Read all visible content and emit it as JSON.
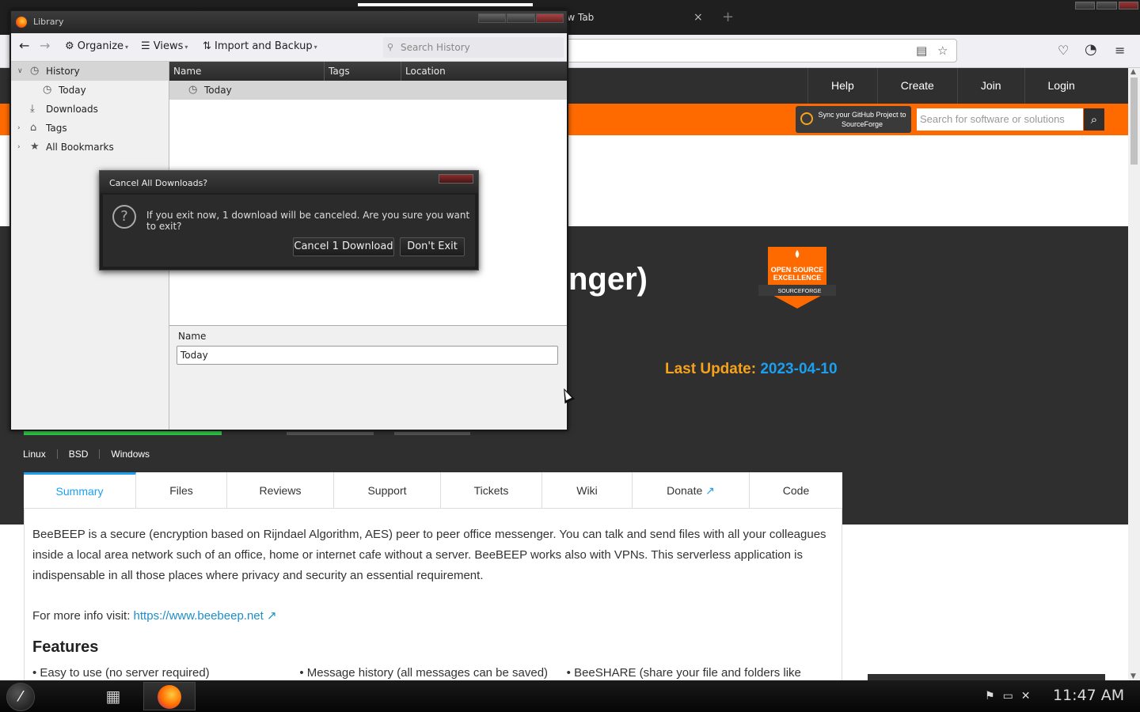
{
  "browser": {
    "tab_title": "New Tab",
    "tab_close": "×",
    "new_tab": "+",
    "reader_icon": "reader-view-icon",
    "bookmark_icon": "star-icon",
    "pocket_icon": "pocket-icon",
    "account_icon": "account-icon",
    "menu_icon": "hamburger-menu-icon"
  },
  "sourceforge": {
    "nav": [
      "Help",
      "Create",
      "Join",
      "Login"
    ],
    "sync_text": "Sync your GitHub Project to SourceForge",
    "search_placeholder": "Search for software or solutions",
    "title_fragment": "nger)",
    "badge_line1": "OPEN SOURCE",
    "badge_line2": "EXCELLENCE",
    "badge_line3": "SOURCEFORGE",
    "last_update_label": "Last Update:",
    "last_update_value": "2023-04-10",
    "platforms": [
      "Linux",
      "BSD",
      "Windows"
    ],
    "tabs": [
      "Summary",
      "Files",
      "Reviews",
      "Support",
      "Tickets",
      "Wiki",
      "Donate",
      "Code"
    ],
    "active_tab": "Summary",
    "description": "BeeBEEP is a secure (encryption based on Rijndael Algorithm, AES) peer to peer office messenger. You can talk and send files with all your colleagues inside a local area network such of an office, home or internet cafe without a server. BeeBEEP works also with VPNs. This serverless application is indispensable in all those places where privacy and security an essential requirement.",
    "more_info_label": "For more info visit:",
    "more_info_link": "https://www.beebeep.net",
    "features_heading": "Features",
    "features": [
      "• Easy to use (no server required)",
      "• Message history (all messages can be saved)",
      "• BeeSHARE (share your file and folders like"
    ]
  },
  "library": {
    "window_title": "Library",
    "toolbar": {
      "organize": "Organize",
      "views": "Views",
      "import_backup": "Import and Backup",
      "search_placeholder": "Search History"
    },
    "sidebar": [
      {
        "label": "History",
        "icon": "clock-icon",
        "expanded": true,
        "selected": true
      },
      {
        "label": "Today",
        "icon": "clock-icon",
        "child": true
      },
      {
        "label": "Downloads",
        "icon": "download-icon"
      },
      {
        "label": "Tags",
        "icon": "tag-icon",
        "collapsed": true
      },
      {
        "label": "All Bookmarks",
        "icon": "star-icon",
        "collapsed": true
      }
    ],
    "columns": [
      "Name",
      "Tags",
      "Location"
    ],
    "rows": [
      {
        "name": "Today"
      }
    ],
    "details": {
      "name_label": "Name",
      "name_value": "Today"
    }
  },
  "dialog": {
    "title": "Cancel All Downloads?",
    "message": "If you exit now, 1 download will be canceled. Are you sure you want to exit?",
    "confirm_button": "Cancel 1 Download",
    "cancel_button": "Don't Exit"
  },
  "taskbar": {
    "clock": "11:47 AM"
  },
  "colors": {
    "sf_orange": "#ff6a00",
    "sf_dark": "#2f2f2f",
    "link_blue": "#1c9ff0",
    "update_gold": "#f7a21b"
  }
}
